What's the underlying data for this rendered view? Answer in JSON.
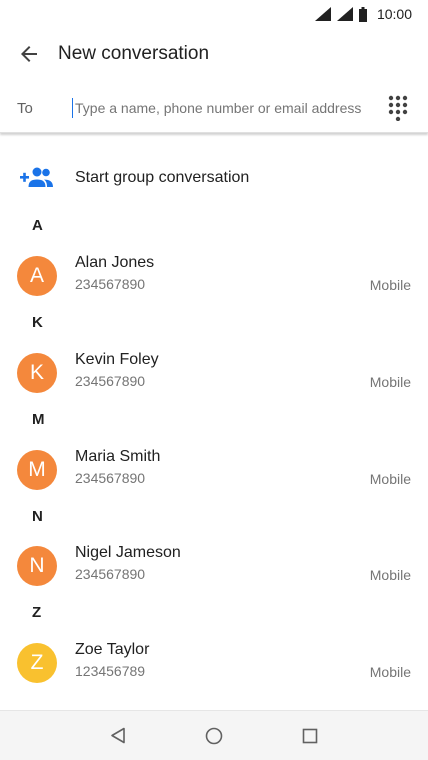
{
  "status_bar": {
    "time": "10:00"
  },
  "app_bar": {
    "title": "New conversation",
    "back_icon": "arrow-back-icon"
  },
  "to_row": {
    "label": "To",
    "placeholder": "Type a name, phone number or email address",
    "dialpad_icon": "dialpad-icon"
  },
  "group": {
    "label": "Start group conversation",
    "icon": "group-add-icon",
    "icon_color": "#1a73e8"
  },
  "sections": [
    {
      "letter": "A",
      "contacts": [
        {
          "initial": "A",
          "name": "Alan Jones",
          "number": "234567890",
          "type": "Mobile",
          "color": "#f4883c"
        }
      ]
    },
    {
      "letter": "K",
      "contacts": [
        {
          "initial": "K",
          "name": "Kevin Foley",
          "number": "234567890",
          "type": "Mobile",
          "color": "#f4883c"
        }
      ]
    },
    {
      "letter": "M",
      "contacts": [
        {
          "initial": "M",
          "name": "Maria Smith",
          "number": "234567890",
          "type": "Mobile",
          "color": "#f4883c"
        }
      ]
    },
    {
      "letter": "N",
      "contacts": [
        {
          "initial": "N",
          "name": "Nigel Jameson",
          "number": "234567890",
          "type": "Mobile",
          "color": "#f4883c"
        }
      ]
    },
    {
      "letter": "Z",
      "contacts": [
        {
          "initial": "Z",
          "name": "Zoe Taylor",
          "number": "123456789",
          "type": "Mobile",
          "color": "#f9c12f"
        }
      ]
    }
  ],
  "nav_bar": {
    "back": "nav-back-icon",
    "home": "nav-home-icon",
    "recents": "nav-recents-icon"
  }
}
